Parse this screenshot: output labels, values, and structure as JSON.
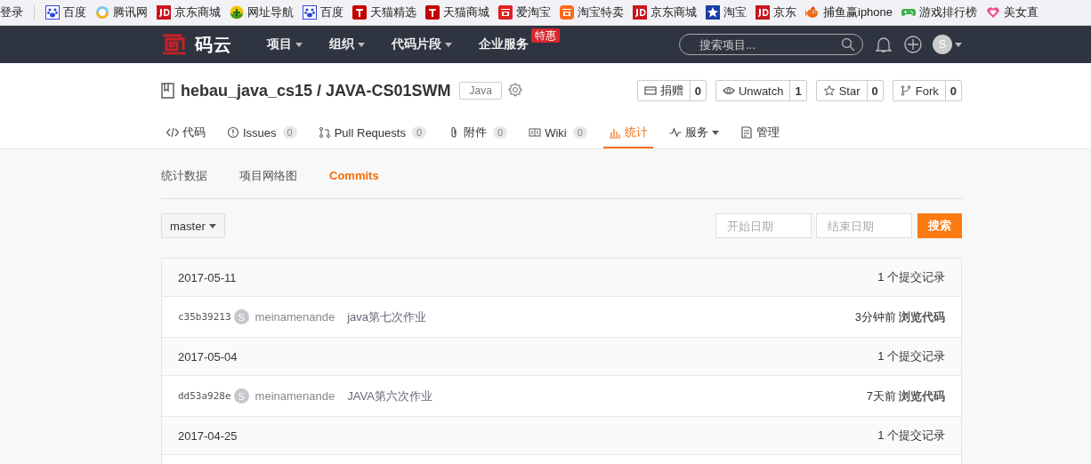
{
  "bookmarks": {
    "login": "登录",
    "items": [
      {
        "label": "百度",
        "kind": "paw"
      },
      {
        "label": "腾讯网",
        "kind": "ring"
      },
      {
        "label": "京东商城",
        "kind": "jd"
      },
      {
        "label": "网址导航",
        "kind": "plus"
      },
      {
        "label": "百度",
        "kind": "paw"
      },
      {
        "label": "天猫精选",
        "kind": "tmall"
      },
      {
        "label": "天猫商城",
        "kind": "tmall"
      },
      {
        "label": "爱淘宝",
        "kind": "tao-red"
      },
      {
        "label": "淘宝特卖",
        "kind": "tao-orange"
      },
      {
        "label": "京东商城",
        "kind": "jd"
      },
      {
        "label": "淘宝",
        "kind": "star"
      },
      {
        "label": "京东",
        "kind": "jd"
      },
      {
        "label": "捕鱼赢iphone",
        "kind": "fish"
      },
      {
        "label": "游戏排行榜",
        "kind": "gamepad"
      },
      {
        "label": "美女直",
        "kind": "heart"
      }
    ]
  },
  "topnav": {
    "logo": "码云",
    "menu": [
      {
        "label": "项目",
        "dropdown": true
      },
      {
        "label": "组织",
        "dropdown": true
      },
      {
        "label": "代码片段",
        "dropdown": true
      },
      {
        "label": "企业服务",
        "dropdown": false,
        "badge": "特惠"
      }
    ],
    "search": {
      "placeholder": "搜索项目..."
    },
    "avatar": "S"
  },
  "repo": {
    "title": "hebau_java_cs15 / JAVA-CS01SWM",
    "language": "Java",
    "actions": [
      {
        "label": "捐赠",
        "count": "0",
        "kind": "donate"
      },
      {
        "label": "Unwatch",
        "count": "1",
        "kind": "eye"
      },
      {
        "label": "Star",
        "count": "0",
        "kind": "star"
      },
      {
        "label": "Fork",
        "count": "0",
        "kind": "fork"
      }
    ],
    "tabs": [
      {
        "label": "代码",
        "kind": "code",
        "selected": false
      },
      {
        "label": "Issues",
        "count": "0",
        "kind": "issue",
        "selected": false
      },
      {
        "label": "Pull Requests",
        "count": "0",
        "kind": "pr",
        "selected": false
      },
      {
        "label": "附件",
        "count": "0",
        "kind": "clip",
        "selected": false
      },
      {
        "label": "Wiki",
        "count": "0",
        "kind": "wiki",
        "selected": false
      },
      {
        "label": "统计",
        "kind": "chart",
        "selected": true
      },
      {
        "label": "服务",
        "kind": "pulse",
        "dropdown": true,
        "selected": false
      },
      {
        "label": "管理",
        "kind": "manage",
        "selected": false
      }
    ]
  },
  "subtabs": [
    {
      "label": "统计数据",
      "selected": false
    },
    {
      "label": "项目网络图",
      "selected": false
    },
    {
      "label": "Commits",
      "selected": true
    }
  ],
  "filters": {
    "branch": "master",
    "start": {
      "placeholder": "开始日期"
    },
    "end": {
      "placeholder": "结束日期"
    },
    "search_button": "搜索"
  },
  "commit_groups": [
    {
      "date": "2017-05-11",
      "count": "1 个提交记录",
      "commits": [
        {
          "hash": "c35b39213",
          "avatar": "S",
          "author": "meinamenande",
          "message": "java第七次作业",
          "time": "3分钟前",
          "browse": "浏览代码"
        }
      ]
    },
    {
      "date": "2017-05-04",
      "count": "1 个提交记录",
      "commits": [
        {
          "hash": "dd53a928e",
          "avatar": "S",
          "author": "meinamenande",
          "message": "JAVA第六次作业",
          "time": "7天前",
          "browse": "浏览代码"
        }
      ]
    },
    {
      "date": "2017-04-25",
      "count": "1 个提交记录"
    }
  ]
}
